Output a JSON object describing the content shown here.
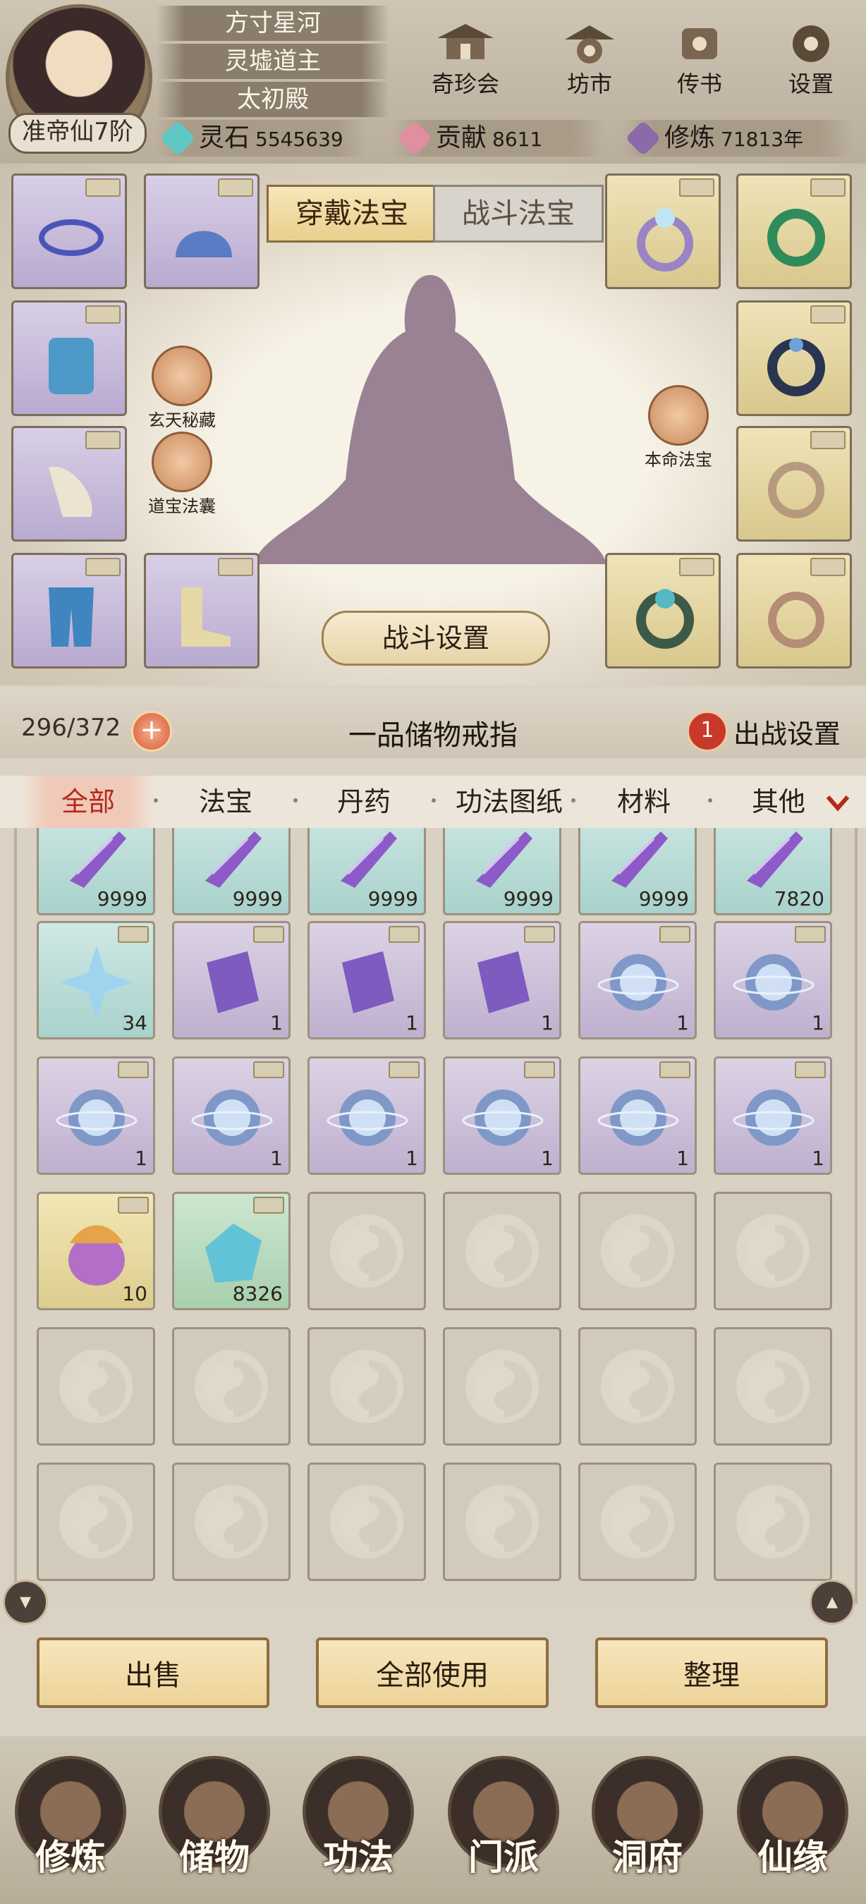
{
  "header": {
    "titles": [
      "方寸星河",
      "灵墟道主",
      "太初殿"
    ],
    "realm": "准帝仙7阶",
    "menu": [
      {
        "label": "奇珍会",
        "icon": "pavilion-icon"
      },
      {
        "label": "坊市",
        "icon": "market-icon"
      },
      {
        "label": "传书",
        "icon": "scroll-icon"
      },
      {
        "label": "设置",
        "icon": "gear-icon"
      }
    ],
    "resources": [
      {
        "label": "灵石",
        "value": "5545639",
        "color": "#5fc7c4"
      },
      {
        "label": "贡献",
        "value": "8611",
        "color": "#e08ea0"
      },
      {
        "label": "修炼",
        "value": "71813年",
        "color": "#8a6aa8"
      }
    ]
  },
  "equipment": {
    "tabs": [
      "穿戴法宝",
      "战斗法宝"
    ],
    "side_buttons": [
      "玄天秘藏",
      "道宝法囊",
      "本命法宝"
    ],
    "battle_settings": "战斗设置"
  },
  "bag": {
    "capacity": "296/372",
    "plus": "+",
    "title": "一品储物戒指",
    "sortie_count": "1",
    "sortie_label": "出战设置",
    "categories": [
      "全部",
      "法宝",
      "丹药",
      "功法图纸",
      "材料",
      "其他"
    ],
    "active_category": "全部",
    "rows": [
      [
        {
          "item": "purple-crystal",
          "count": "9999",
          "rarity": "teal"
        },
        {
          "item": "purple-crystal",
          "count": "9999",
          "rarity": "teal"
        },
        {
          "item": "purple-crystal",
          "count": "9999",
          "rarity": "teal"
        },
        {
          "item": "purple-crystal",
          "count": "9999",
          "rarity": "teal"
        },
        {
          "item": "purple-crystal",
          "count": "9999",
          "rarity": "teal"
        },
        {
          "item": "purple-crystal",
          "count": "7820",
          "rarity": "teal"
        }
      ],
      [
        {
          "item": "ice-star",
          "count": "34",
          "rarity": "teal"
        },
        {
          "item": "purple-talisman",
          "count": "1",
          "rarity": "purple"
        },
        {
          "item": "purple-talisman",
          "count": "1",
          "rarity": "purple"
        },
        {
          "item": "purple-talisman",
          "count": "1",
          "rarity": "purple"
        },
        {
          "item": "spirit-orb",
          "count": "1",
          "rarity": "purple"
        },
        {
          "item": "spirit-orb",
          "count": "1",
          "rarity": "purple"
        }
      ],
      [
        {
          "item": "spirit-orb",
          "count": "1",
          "rarity": "purple"
        },
        {
          "item": "spirit-orb",
          "count": "1",
          "rarity": "purple"
        },
        {
          "item": "spirit-orb",
          "count": "1",
          "rarity": "purple"
        },
        {
          "item": "spirit-orb",
          "count": "1",
          "rarity": "purple"
        },
        {
          "item": "spirit-orb",
          "count": "1",
          "rarity": "purple"
        },
        {
          "item": "spirit-orb",
          "count": "1",
          "rarity": "purple"
        }
      ],
      [
        {
          "item": "lotus-fruit",
          "count": "10",
          "rarity": "gold"
        },
        {
          "item": "blue-stone",
          "count": "8326",
          "rarity": "green"
        },
        null,
        null,
        null,
        null
      ],
      [
        null,
        null,
        null,
        null,
        null,
        null
      ],
      [
        null,
        null,
        null,
        null,
        null,
        null
      ]
    ]
  },
  "actions": [
    "出售",
    "全部使用",
    "整理"
  ],
  "nav": [
    {
      "label": "修炼",
      "active": false
    },
    {
      "label": "储物",
      "active": true
    },
    {
      "label": "功法",
      "active": false
    },
    {
      "label": "门派",
      "active": false
    },
    {
      "label": "洞府",
      "active": false
    },
    {
      "label": "仙缘",
      "active": false
    }
  ]
}
